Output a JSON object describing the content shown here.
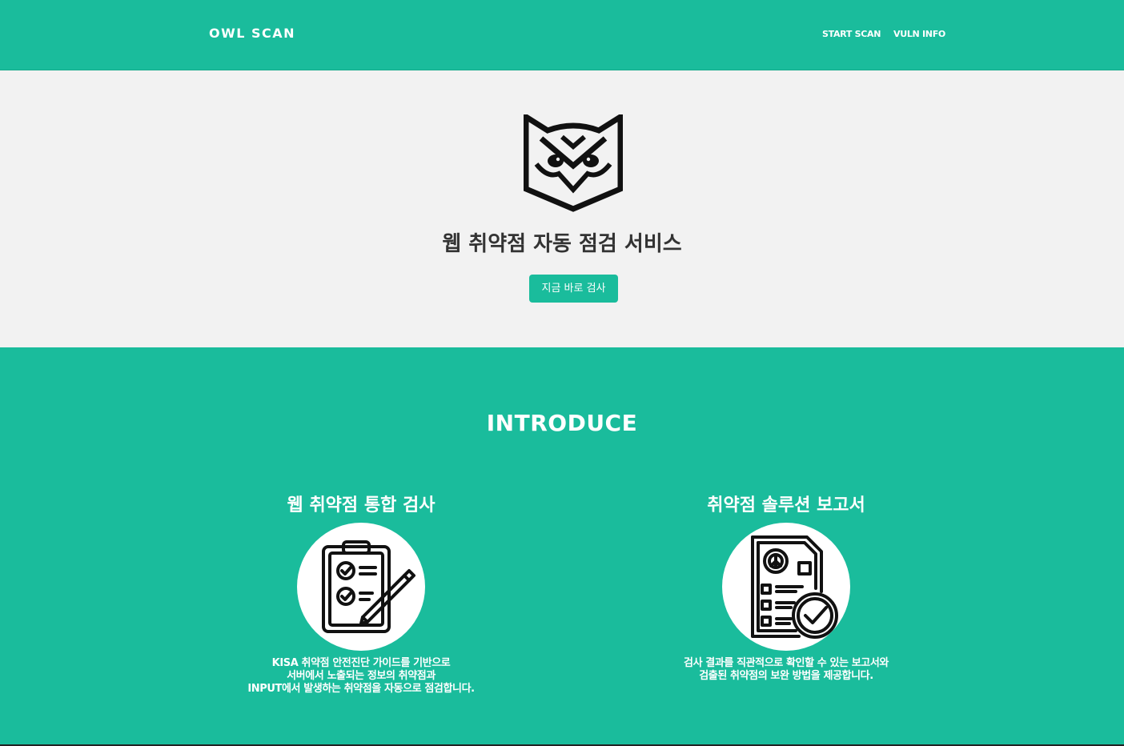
{
  "navbar": {
    "brand": "OWL SCAN",
    "links": [
      {
        "label": "START SCAN"
      },
      {
        "label": "VULN INFO"
      }
    ]
  },
  "hero": {
    "logo_icon": "owl-logo-icon",
    "title": "웹 취약점 자동 점검 서비스",
    "button_label": "지금 바로 검사"
  },
  "introduce": {
    "title": "INTRODUCE",
    "features": [
      {
        "title": "웹 취약점 통합 검사",
        "icon": "checklist-clipboard-icon",
        "description": "KISA 취약점 안전진단 가이드를 기반으로\n서버에서 노출되는 정보의 취약점과\nINPUT에서 발생하는 취약점을 자동으로 점검합니다."
      },
      {
        "title": "취약점 솔루션 보고서",
        "icon": "report-document-check-icon",
        "description": "검사 결과를 직관적으로 확인할 수 있는 보고서와\n검출된 취약점의 보완 방법을 제공합니다."
      }
    ]
  },
  "colors": {
    "accent": "#1abc9c",
    "hero_background": "#f2f2f2",
    "title_text": "#333333"
  }
}
